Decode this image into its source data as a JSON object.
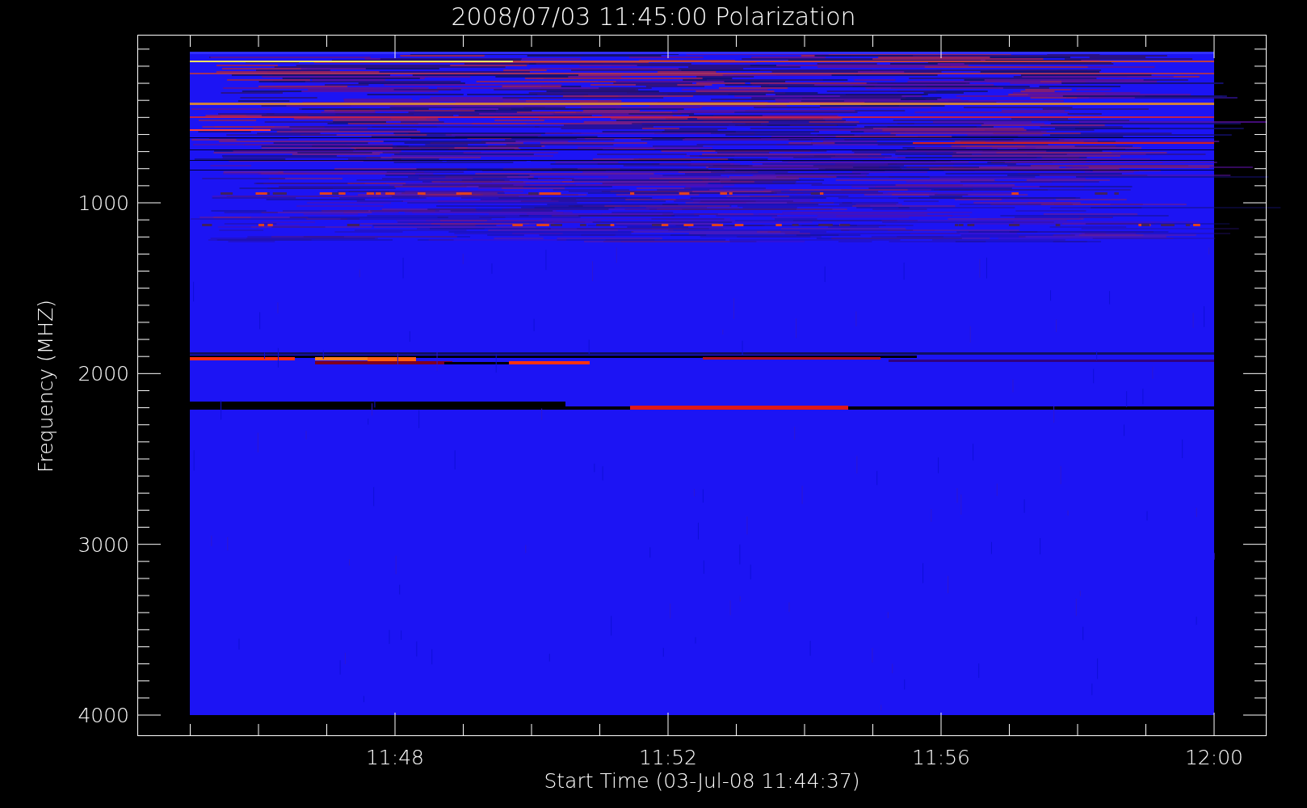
{
  "title": "2008/07/03 11:45:00 Polarization",
  "x_axis": {
    "label": "Start Time (03-Jul-08 11:44:37)",
    "ticks": [
      "11:48",
      "11:52",
      "11:56",
      "12:00"
    ]
  },
  "y_axis": {
    "label": "Frequency (MHZ)",
    "ticks": [
      "1000",
      "2000",
      "3000",
      "4000"
    ]
  }
}
